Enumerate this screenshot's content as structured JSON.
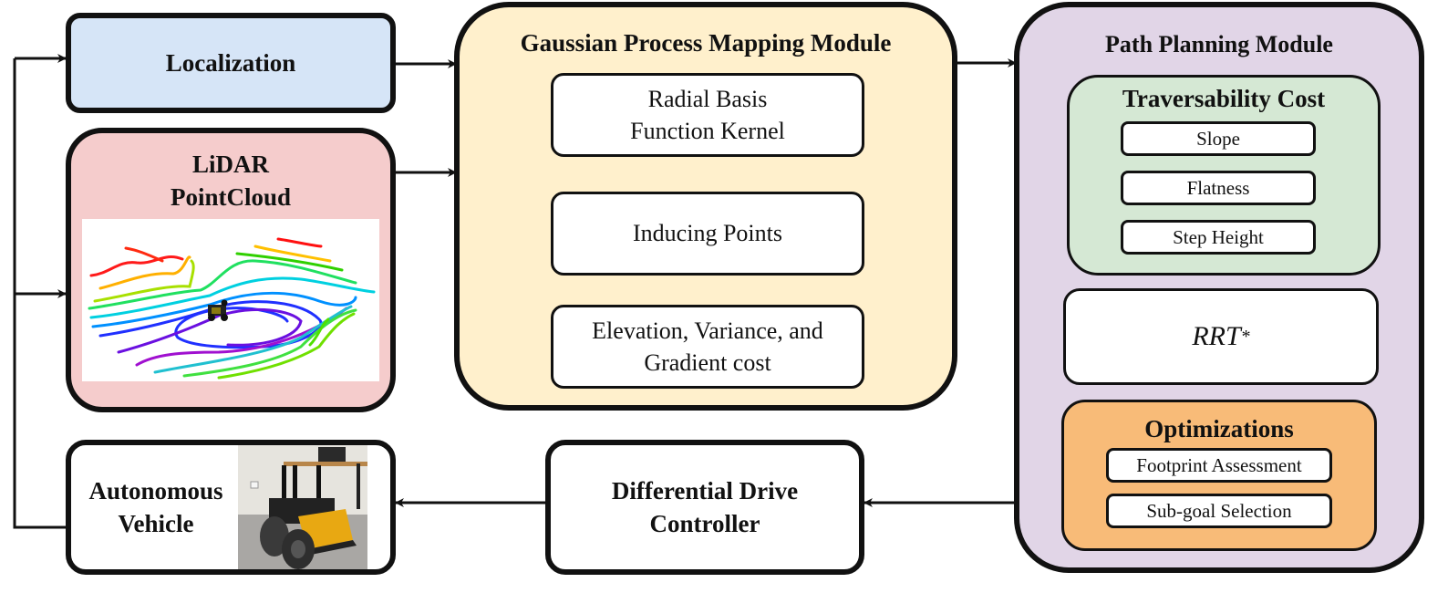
{
  "diagram": {
    "localization": {
      "label": "Localization",
      "color": "#d6e5f7"
    },
    "lidar": {
      "label_line1": "LiDAR",
      "label_line2": "PointCloud",
      "color": "#f5cccc",
      "image": "lidar-pointcloud-contour-visualization"
    },
    "autonomous_vehicle": {
      "label_line1": "Autonomous",
      "label_line2": "Vehicle",
      "image": "robot-photo"
    },
    "gp_module": {
      "title": "Gaussian Process Mapping Module",
      "color": "#fff0cc",
      "items": [
        {
          "line1": "Radial Basis",
          "line2": "Function Kernel"
        },
        {
          "line1": "Inducing Points",
          "line2": ""
        },
        {
          "line1": "Elevation, Variance, and",
          "line2": "Gradient cost"
        }
      ]
    },
    "path_planning": {
      "title": "Path Planning Module",
      "color": "#e1d5e7",
      "traversability": {
        "title": "Traversability Cost",
        "color": "#d5e8d4",
        "items": [
          "Slope",
          "Flatness",
          "Step Height"
        ]
      },
      "planner": {
        "label": "RRT",
        "superscript": "*"
      },
      "optimizations": {
        "title": "Optimizations",
        "color": "#f8bb78",
        "items": [
          "Footprint Assessment",
          "Sub-goal Selection"
        ]
      }
    },
    "controller": {
      "label_line1": "Differential Drive",
      "label_line2": "Controller"
    },
    "edges": [
      {
        "from": "Localization",
        "to": "Gaussian Process Mapping Module"
      },
      {
        "from": "LiDAR PointCloud",
        "to": "Gaussian Process Mapping Module"
      },
      {
        "from": "Gaussian Process Mapping Module",
        "to": "Path Planning Module"
      },
      {
        "from": "Path Planning Module",
        "to": "Differential Drive Controller"
      },
      {
        "from": "Differential Drive Controller",
        "to": "Autonomous Vehicle"
      },
      {
        "from": "Autonomous Vehicle",
        "to": "Localization"
      },
      {
        "from": "Autonomous Vehicle",
        "to": "LiDAR PointCloud"
      }
    ]
  }
}
